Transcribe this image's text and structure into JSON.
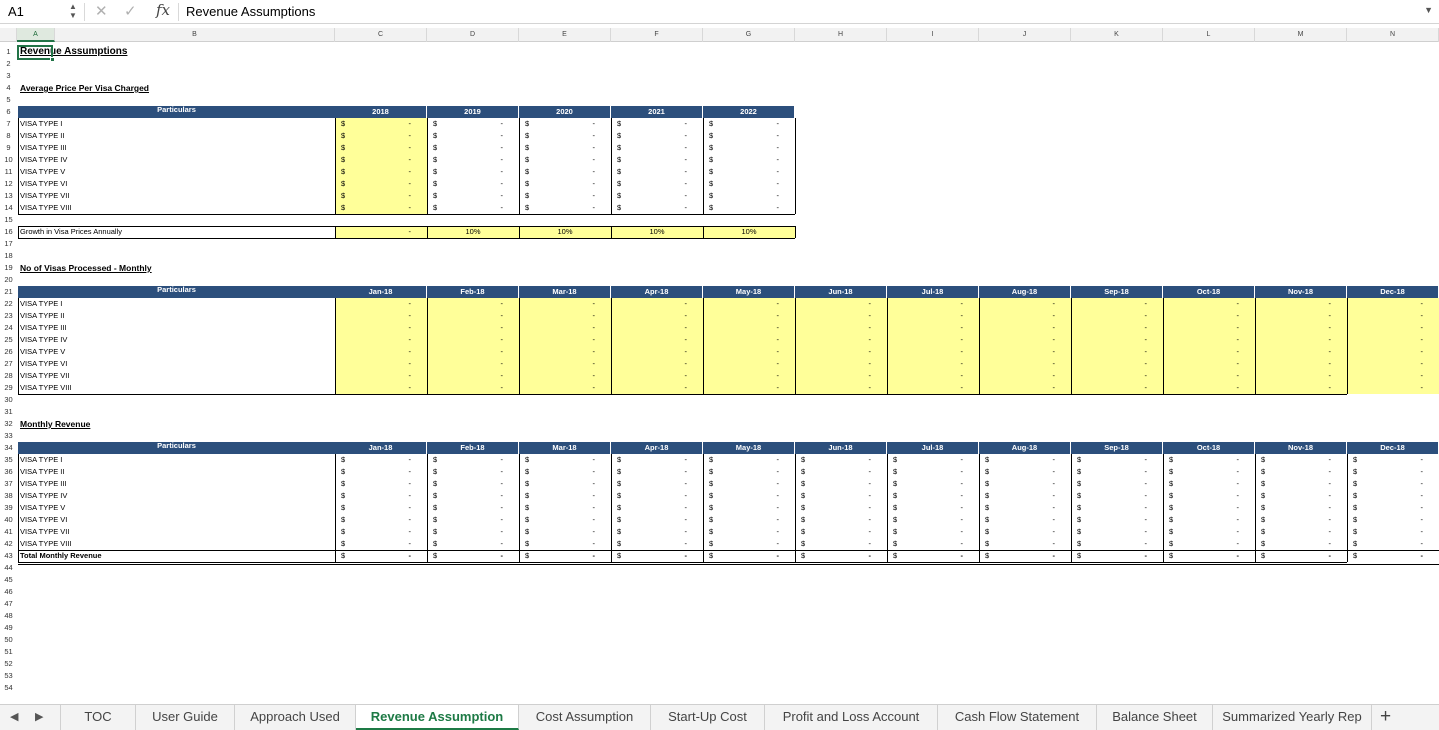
{
  "formula_bar": {
    "name_box": "A1",
    "formula": "Revenue Assumptions"
  },
  "columns": [
    "A",
    "B",
    "C",
    "D",
    "E",
    "F",
    "G",
    "H",
    "I",
    "J",
    "K",
    "L",
    "M",
    "N"
  ],
  "rows": [
    "1",
    "2",
    "3",
    "4",
    "5",
    "6",
    "7",
    "8",
    "9",
    "10",
    "11",
    "12",
    "13",
    "14",
    "15",
    "16",
    "17",
    "18",
    "19",
    "20",
    "21",
    "22",
    "23",
    "24",
    "25",
    "26",
    "27",
    "28",
    "29",
    "30",
    "31",
    "32",
    "33",
    "34",
    "35",
    "36",
    "37",
    "38",
    "39",
    "40",
    "41",
    "42",
    "43",
    "44",
    "45",
    "46",
    "47",
    "48",
    "49",
    "50",
    "51",
    "52",
    "53",
    "54"
  ],
  "sheet_title": "Revenue Assumptions",
  "particulars_label": "Particulars",
  "currency_symbol": "$",
  "dash": "-",
  "visa_types": [
    "VISA TYPE I",
    "VISA TYPE II",
    "VISA TYPE III",
    "VISA TYPE IV",
    "VISA TYPE V",
    "VISA TYPE VI",
    "VISA TYPE VII",
    "VISA TYPE VIII"
  ],
  "price_section": {
    "title": "Average Price Per Visa Charged",
    "years": [
      "2018",
      "2019",
      "2020",
      "2021",
      "2022"
    ]
  },
  "growth_row": {
    "label": "Growth in Visa Prices Annually",
    "values": [
      "-",
      "10%",
      "10%",
      "10%",
      "10%"
    ]
  },
  "visas_section": {
    "title": "No of Visas Processed - Monthly"
  },
  "revenue_section": {
    "title": "Monthly Revenue",
    "total_label": "Total Monthly Revenue"
  },
  "months": [
    "Jan-18",
    "Feb-18",
    "Mar-18",
    "Apr-18",
    "May-18",
    "Jun-18",
    "Jul-18",
    "Aug-18",
    "Sep-18",
    "Oct-18",
    "Nov-18",
    "Dec-18"
  ],
  "sheet_tabs": [
    "TOC",
    "User Guide",
    "Approach Used",
    "Revenue Assumption",
    "Cost Assumption",
    "Start-Up Cost",
    "Profit and Loss Account",
    "Cash Flow Statement",
    "Balance Sheet",
    "Summarized Yearly Rep"
  ],
  "active_tab": "Revenue Assumption",
  "colors": {
    "header_band": "#2c4f7c",
    "input_yellow": "#ffff99",
    "accent_green": "#217346"
  }
}
